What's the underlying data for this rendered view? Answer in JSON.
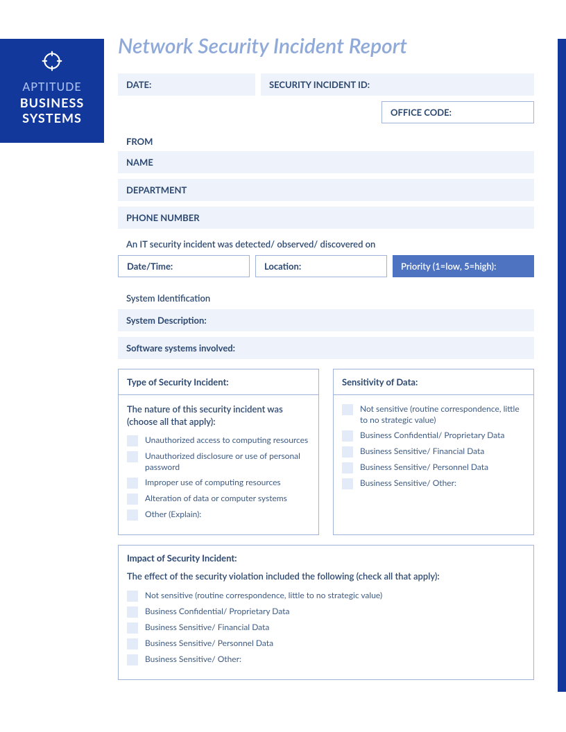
{
  "brand": {
    "line1": "APTITUDE",
    "line2": "BUSINESS",
    "line3": "SYSTEMS"
  },
  "title": "Network Security Incident Report",
  "header": {
    "date": "DATE:",
    "incident_id": "SECURITY INCIDENT ID:",
    "office_code": "OFFICE CODE:"
  },
  "from": {
    "label": "FROM",
    "name": "NAME",
    "department": "DEPARTMENT",
    "phone": "PHONE NUMBER"
  },
  "detected": {
    "intro": "An IT security incident was detected/ observed/ discovered on",
    "datetime": "Date/Time:",
    "location": "Location:",
    "priority": "Priority (1=low, 5=high):"
  },
  "sysid": {
    "label": "System Identification",
    "desc": "System Description:",
    "software": "Software systems involved:"
  },
  "type_panel": {
    "head": "Type of Security Incident:",
    "intro": "The nature of this security incident was (choose all that apply):",
    "opts": [
      "Unauthorized access to computing resources",
      "Unauthorized disclosure or use of personal password",
      "Improper use of computing resources",
      "Alteration of data or computer systems",
      "Other (Explain):"
    ]
  },
  "sens_panel": {
    "head": "Sensitivity of Data:",
    "opts": [
      "Not sensitive (routine correspondence, little to no strategic value)",
      "Business Confidential/ Proprietary Data",
      "Business Sensitive/ Financial Data",
      "Business Sensitive/ Personnel Data",
      "Business Sensitive/ Other:"
    ]
  },
  "impact_panel": {
    "head": "Impact of Security Incident:",
    "intro": "The effect of the security violation included the following (check all that apply):",
    "opts": [
      "Not sensitive (routine correspondence, little to no strategic value)",
      "Business Confidential/ Proprietary Data",
      "Business Sensitive/ Financial Data",
      "Business Sensitive/ Personnel Data",
      "Business Sensitive/ Other:"
    ]
  }
}
